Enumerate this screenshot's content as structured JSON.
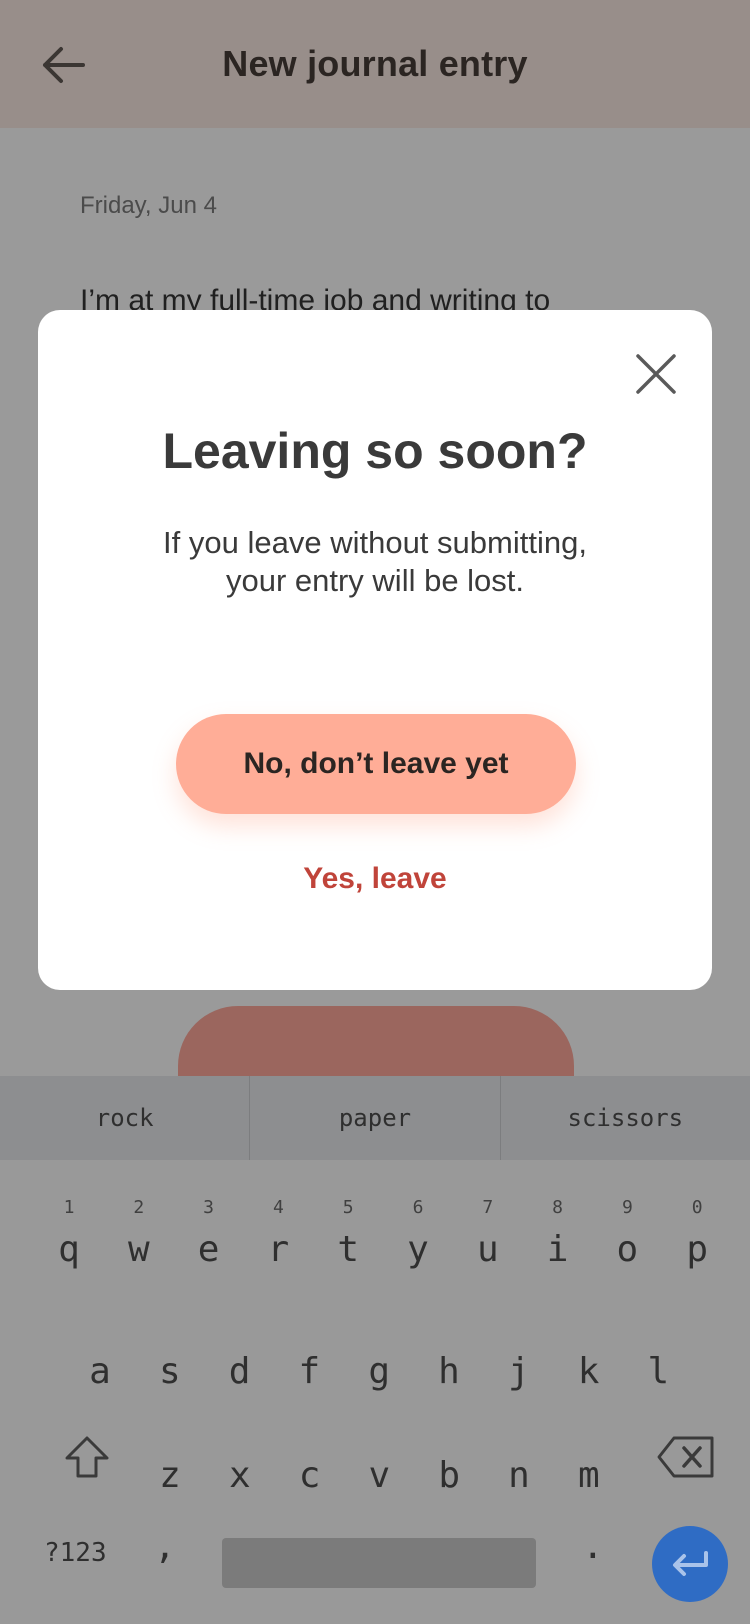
{
  "header": {
    "title": "New journal entry",
    "back_icon": "arrow-left-icon"
  },
  "entry": {
    "date": "Friday, Jun 4",
    "text": "I’m at my full-time job and writing to"
  },
  "suggestions": [
    "rock",
    "paper",
    "scissors"
  ],
  "keyboard": {
    "row1": [
      {
        "num": "1",
        "letter": "q"
      },
      {
        "num": "2",
        "letter": "w"
      },
      {
        "num": "3",
        "letter": "e"
      },
      {
        "num": "4",
        "letter": "r"
      },
      {
        "num": "5",
        "letter": "t"
      },
      {
        "num": "6",
        "letter": "y"
      },
      {
        "num": "7",
        "letter": "u"
      },
      {
        "num": "8",
        "letter": "i"
      },
      {
        "num": "9",
        "letter": "o"
      },
      {
        "num": "0",
        "letter": "p"
      }
    ],
    "row2": [
      "a",
      "s",
      "d",
      "f",
      "g",
      "h",
      "j",
      "k",
      "l"
    ],
    "row3": [
      "z",
      "x",
      "c",
      "v",
      "b",
      "n",
      "m"
    ],
    "symbols_label": "?123",
    "comma": ",",
    "period": ".",
    "enter_color": "#2f6cc4"
  },
  "modal": {
    "title": "Leaving so soon?",
    "body_line1": "If you leave without submitting,",
    "body_line2": "your entry will be lost.",
    "stay_label": "No, don’t leave yet",
    "leave_label": "Yes, leave",
    "stay_color": "#ffad97",
    "leave_color": "#c0443a"
  }
}
